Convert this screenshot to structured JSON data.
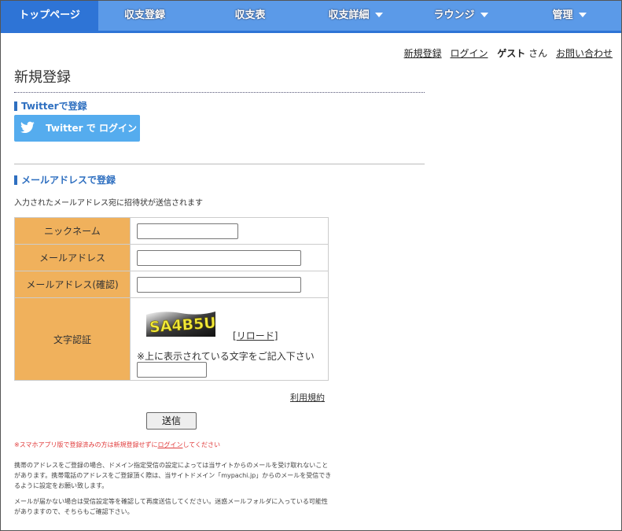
{
  "nav": {
    "items": [
      {
        "label": "トップページ",
        "active": true,
        "dropdown": false
      },
      {
        "label": "収支登録",
        "active": false,
        "dropdown": false
      },
      {
        "label": "収支表",
        "active": false,
        "dropdown": false
      },
      {
        "label": "収支詳細",
        "active": false,
        "dropdown": true
      },
      {
        "label": "ラウンジ",
        "active": false,
        "dropdown": true
      },
      {
        "label": "管理",
        "active": false,
        "dropdown": true
      }
    ]
  },
  "userbar": {
    "register": "新規登録",
    "login": "ログイン",
    "guest": "ゲスト",
    "san": "さん",
    "contact": "お問い合わせ"
  },
  "page": {
    "title": "新規登録",
    "twitter_section": "Twitterで登録",
    "twitter_button": "Twitter で ログイン",
    "email_section": "メールアドレスで登録",
    "invite_note": "入力されたメールアドレス宛に招待状が送信されます"
  },
  "form": {
    "nickname_label": "ニックネーム",
    "email_label": "メールアドレス",
    "email_confirm_label": "メールアドレス(確認)",
    "captcha_label": "文字認証",
    "captcha_text": "SA4B5U",
    "reload_open": "[",
    "reload_label": "リロード",
    "reload_close": "]",
    "captcha_instruction": "※上に表示されている文字をご記入下さい",
    "nickname_value": "",
    "email_value": "",
    "email_confirm_value": "",
    "captcha_value": ""
  },
  "terms_link": "利用規約",
  "submit_label": "送信",
  "notes": {
    "app_warning_prefix": "※スマホアプリ版で登録済みの方は新規登録せずに",
    "app_warning_link": "ログイン",
    "app_warning_suffix": "してください",
    "mobile_note": "携帯のアドレスをご登録の場合、ドメイン指定受信の設定によっては当サイトからのメールを受け取れないことがあります。携帯電話のアドレスをご登録頂く際は、当サイトドメイン「mypachi.jp」からのメールを受信できるように設定をお願い致します。",
    "nomail_note": "メールが届かない場合は受信設定等を確認して再度送信してください。迷惑メールフォルダに入っている可能性がありますので、そちらもご確認下さい。"
  },
  "colors": {
    "nav_bg": "#5b9ae8",
    "nav_active": "#2e74d6",
    "twitter_blue": "#55acee",
    "label_orange": "#f0b15c",
    "section_blue": "#2e6fc0",
    "warning_red": "#e03a3a"
  }
}
